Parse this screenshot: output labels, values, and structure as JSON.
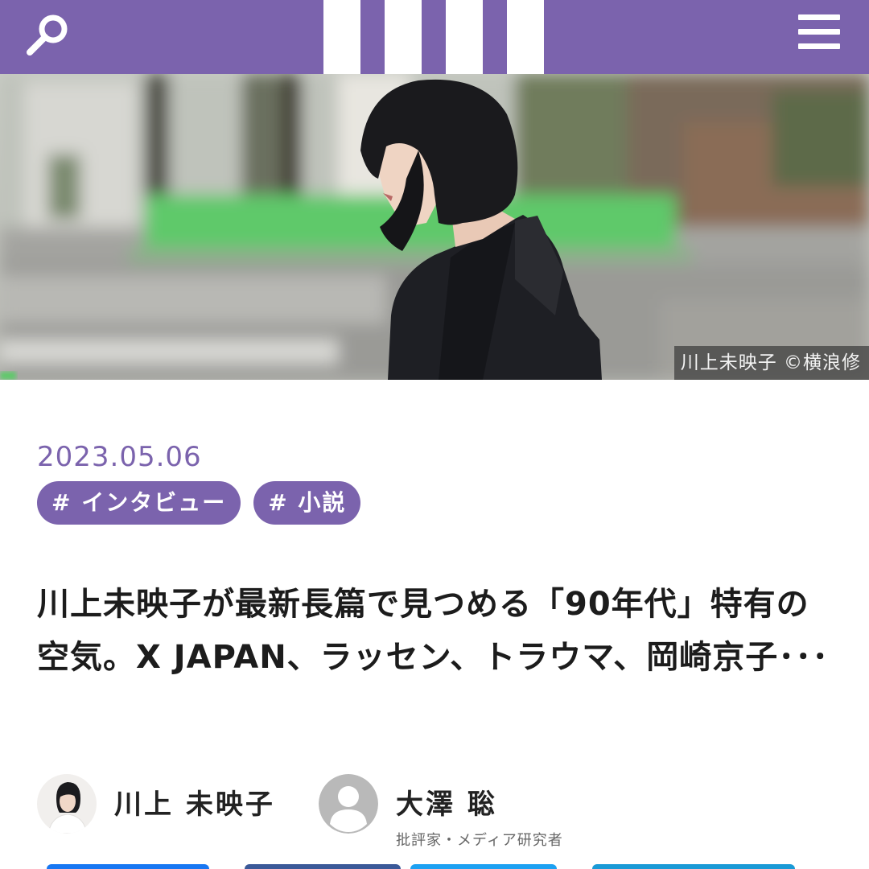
{
  "header": {
    "search_icon": "search-icon",
    "logo_icon": "striped-logo",
    "menu_icon": "hamburger-menu-icon",
    "brand_color": "#7b63ad"
  },
  "hero": {
    "credit": "川上未映子 ©横浪修"
  },
  "article": {
    "date": "2023.05.06",
    "tags": [
      "# インタビュー",
      "# 小説"
    ],
    "title": "川上未映子が最新長篇で見つめる「90年代」特有の空気。X JAPAN、ラッセン、トラウマ、岡崎京子･･･"
  },
  "authors": [
    {
      "name": "川上 未映子",
      "role": ""
    },
    {
      "name": "大澤 聡",
      "role": "批評家・メディア研究者"
    }
  ],
  "share": {
    "colors": [
      "#1877f2",
      "#3b5998",
      "#1da1f2",
      "#1a9ad6"
    ]
  }
}
